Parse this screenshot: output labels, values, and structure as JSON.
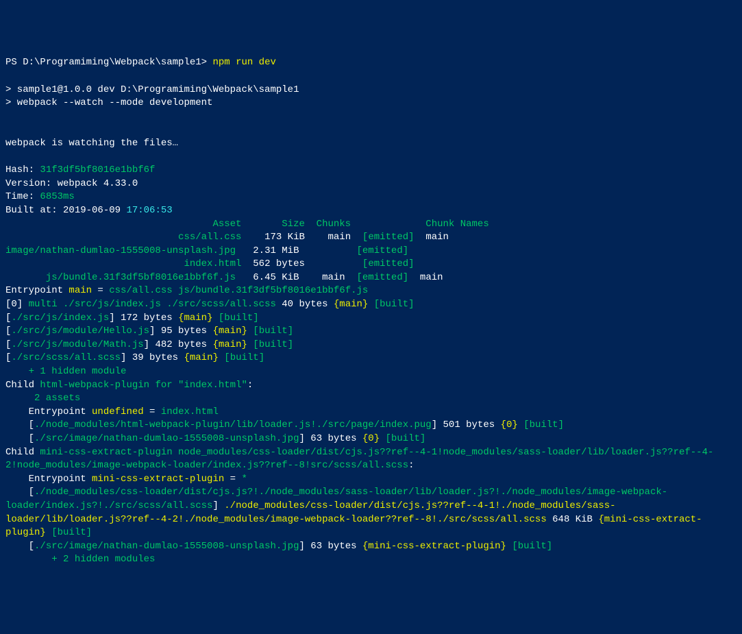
{
  "prompt": {
    "ps": "PS ",
    "path": "D:\\Programiming\\Webpack\\sample1> ",
    "cmd": "npm run dev"
  },
  "npm": {
    "line1": "> sample1@1.0.0 dev D:\\Programiming\\Webpack\\sample1",
    "line2": "> webpack --watch --mode development"
  },
  "watch": "webpack is watching the files…",
  "hash": {
    "label": "Hash: ",
    "value": "31f3df5bf8016e1bbf6f"
  },
  "version": {
    "label": "Version: ",
    "value": "webpack 4.33.0"
  },
  "time": {
    "label": "Time: ",
    "value": "6853ms"
  },
  "built": {
    "label": "Built at: ",
    "value": "2019-06-09 ",
    "time": "17:06:53"
  },
  "tableHeader": "                                    Asset       Size  Chunks             Chunk Names",
  "assets": [
    {
      "name": "                              css/all.css",
      "size": "    173 KiB",
      "chunk": "    main",
      "status": "  [emitted]",
      "cn": "  main"
    },
    {
      "name": "image/nathan-dumlao-1555008-unsplash.jpg",
      "size": "   2.31 MiB",
      "chunk": "        ",
      "status": "  [emitted]",
      "cn": "  "
    },
    {
      "name": "                               index.html",
      "size": "  562 bytes",
      "chunk": "        ",
      "status": "  [emitted]",
      "cn": "  "
    },
    {
      "name": "       js/bundle.31f3df5bf8016e1bbf6f.js",
      "size": "   6.45 KiB",
      "chunk": "    main",
      "status": "  [emitted]",
      "cn": "  main"
    }
  ],
  "entrypoint": {
    "prefix": "Entrypoint ",
    "name": "main",
    "eq": " = ",
    "files": "css/all.css js/bundle.31f3df5bf8016e1bbf6f.js"
  },
  "modules": [
    {
      "prefix": "[0] ",
      "path": "multi ./src/js/index.js ./src/scss/all.scss",
      "size": " 40 bytes ",
      "chunk": "{main}",
      "built": " [built]"
    },
    {
      "prefix": "[",
      "path": "./src/js/index.js",
      "suffix": "] 172 bytes ",
      "chunk": "{main}",
      "built": " [built]"
    },
    {
      "prefix": "[",
      "path": "./src/js/module/Hello.js",
      "suffix": "] 95 bytes ",
      "chunk": "{main}",
      "built": " [built]"
    },
    {
      "prefix": "[",
      "path": "./src/js/module/Math.js",
      "suffix": "] 482 bytes ",
      "chunk": "{main}",
      "built": " [built]"
    },
    {
      "prefix": "[",
      "path": "./src/scss/all.scss",
      "suffix": "] 39 bytes ",
      "chunk": "{main}",
      "built": " [built]"
    }
  ],
  "hidden1": "    + 1 hidden module",
  "child1": {
    "prefix": "Child ",
    "name": "html-webpack-plugin for \"index.html\"",
    "colon": ":"
  },
  "child1_assets": "     2 assets",
  "child1_entry": {
    "prefix": "    Entrypoint ",
    "name": "undefined",
    "eq": " = ",
    "file": "index.html"
  },
  "child1_mods": [
    {
      "prefix": "    [",
      "path": "./node_modules/html-webpack-plugin/lib/loader.js!./src/page/index.pug",
      "suffix": "] 501 bytes ",
      "chunk": "{0}",
      "built": " [built]"
    },
    {
      "prefix": "    [",
      "path": "./src/image/nathan-dumlao-1555008-unsplash.jpg",
      "suffix": "] 63 bytes ",
      "chunk": "{0}",
      "built": " [built]"
    }
  ],
  "child2": {
    "prefix": "Child ",
    "name": "mini-css-extract-plugin node_modules/css-loader/dist/cjs.js??ref--4-1!node_modules/sass-loader/lib/loader.js??ref--4-2!node_modules/image-webpack-loader/index.js??ref--8!src/scss/all.scss",
    "colon": ":"
  },
  "child2_entry": {
    "prefix": "    Entrypoint ",
    "name": "mini-css-extract-plugin",
    "eq": " = ",
    "file": "*"
  },
  "child2_mod1": {
    "prefix": "    [",
    "path": "./node_modules/css-loader/dist/cjs.js?!./node_modules/sass-loader/lib/loader.js?!./node_modules/image-webpack-loader/index.js?!./src/scss/all.scss",
    "suffix": "] ",
    "alias": "./node_modules/css-loader/dist/cjs.js??ref--4-1!./node_modules/sass-loader/lib/loader.js??ref--4-2!./node_modules/image-webpack-loader??ref--8!./src/scss/all.scss",
    "size": " 648 KiB ",
    "chunk": "{mini-css-extract-plugin}",
    "built": " [built]"
  },
  "child2_mod2": {
    "prefix": "    [",
    "path": "./src/image/nathan-dumlao-1555008-unsplash.jpg",
    "suffix": "] 63 bytes ",
    "chunk": "{mini-css-extract-plugin}",
    "built": " [built]"
  },
  "hidden2": "        + 2 hidden modules"
}
